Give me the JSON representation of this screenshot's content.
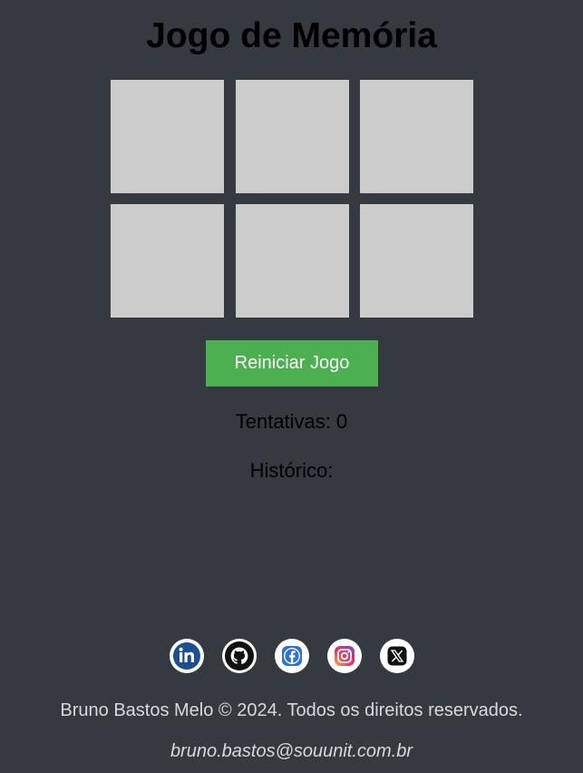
{
  "header": {
    "title": "Jogo de Memória"
  },
  "board": {
    "cards": [
      {
        "state": "face-down"
      },
      {
        "state": "face-down"
      },
      {
        "state": "face-down"
      },
      {
        "state": "face-down"
      },
      {
        "state": "face-down"
      },
      {
        "state": "face-down"
      }
    ],
    "card_color": "#cccccc"
  },
  "controls": {
    "restart_label": "Reiniciar Jogo",
    "restart_color": "#4caf50"
  },
  "stats": {
    "attempts_text": "Tentativas: 0",
    "history_label": "Histórico:"
  },
  "social": {
    "links": [
      {
        "icon": "linkedin-icon"
      },
      {
        "icon": "github-icon"
      },
      {
        "icon": "facebook-icon"
      },
      {
        "icon": "instagram-icon"
      },
      {
        "icon": "x-twitter-icon"
      }
    ]
  },
  "footer": {
    "copyright": "Bruno Bastos Melo © 2024. Todos os direitos reservados.",
    "email": "bruno.bastos@souunit.com.br"
  },
  "colors": {
    "background": "#343a40",
    "footer_text": "#d9d9d9"
  }
}
